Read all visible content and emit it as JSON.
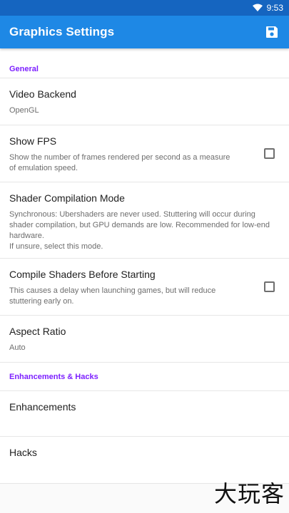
{
  "status_bar": {
    "time": "9:53",
    "wifi_icon": "wifi-icon"
  },
  "app_bar": {
    "title": "Graphics Settings",
    "save_icon": "save-icon",
    "color": "#1e88e5"
  },
  "sections": {
    "general": {
      "header": "General",
      "items": {
        "video_backend": {
          "title": "Video Backend",
          "subtitle": "OpenGL"
        },
        "show_fps": {
          "title": "Show FPS",
          "subtitle": "Show the number of frames rendered per second as a measure\nof emulation speed.",
          "checked": false
        },
        "shader_mode": {
          "title": "Shader Compilation Mode",
          "subtitle": "Synchronous: Ubershaders are never used. Stuttering will occur during shader compilation, but GPU demands are low. Recommended for low-end hardware.\nIf unsure, select this mode."
        },
        "compile_before": {
          "title": "Compile Shaders Before Starting",
          "subtitle": "This causes a delay when launching games, but will reduce\nstuttering early on.",
          "checked": false
        },
        "aspect_ratio": {
          "title": "Aspect Ratio",
          "subtitle": "Auto"
        }
      }
    },
    "enhancements": {
      "header": "Enhancements & Hacks",
      "items": {
        "enhancements": {
          "title": "Enhancements"
        },
        "hacks": {
          "title": "Hacks"
        }
      }
    }
  },
  "watermark": "大玩客",
  "colors": {
    "section_header": "#7c1fff",
    "status_bar": "#1565c0"
  }
}
